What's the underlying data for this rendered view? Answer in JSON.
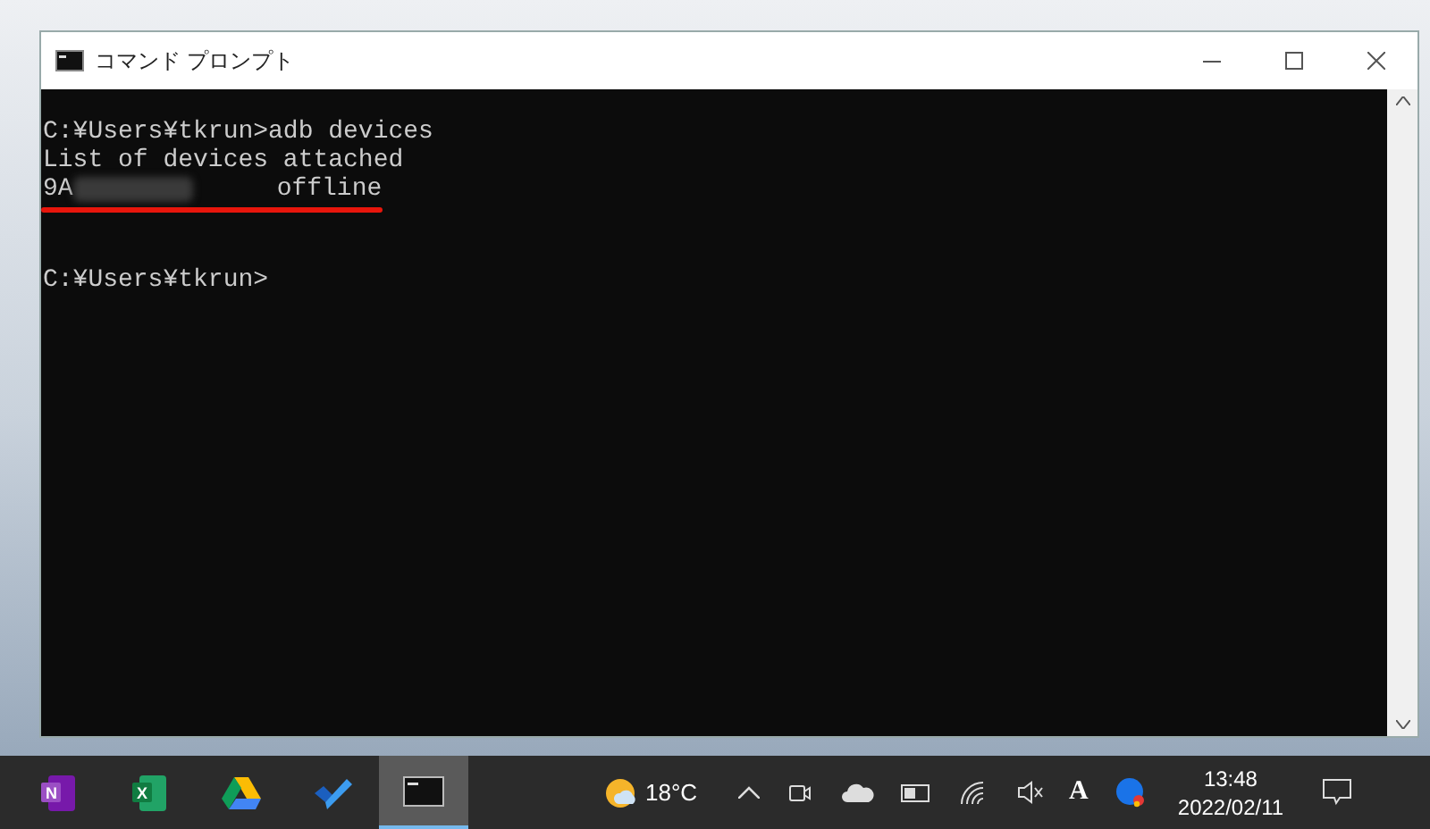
{
  "window": {
    "title": "コマンド プロンプト"
  },
  "console": {
    "lines": [
      {
        "kind": "text",
        "text": "C:¥Users¥tkrun>adb devices"
      },
      {
        "kind": "text",
        "text": "List of devices attached"
      },
      {
        "kind": "device",
        "id_visible": "9A",
        "status": "offline",
        "redacted": true,
        "underlined": true
      },
      {
        "kind": "blank"
      },
      {
        "kind": "text",
        "text": "C:¥Users¥tkrun>"
      }
    ]
  },
  "taskbar": {
    "apps": [
      {
        "kind": "onenote",
        "badge": "N",
        "selected": false
      },
      {
        "kind": "excel",
        "badge": "X",
        "selected": false
      },
      {
        "kind": "drive",
        "selected": false
      },
      {
        "kind": "todo",
        "selected": false
      },
      {
        "kind": "console",
        "selected": true
      }
    ],
    "weather": {
      "temperature": "18°C"
    },
    "ime": "A",
    "clock": {
      "time": "13:48",
      "date": "2022/02/11"
    }
  }
}
